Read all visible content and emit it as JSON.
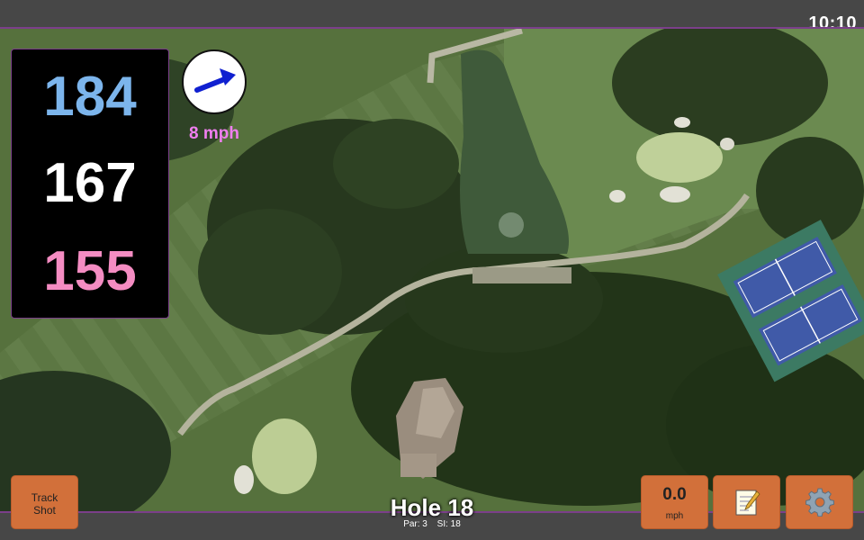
{
  "status_bar": {
    "time": "10:10"
  },
  "distances": {
    "back": "184",
    "middle": "167",
    "front": "155"
  },
  "wind": {
    "speed_label": "8 mph",
    "direction_icon": "arrow-icon"
  },
  "buttons": {
    "track_shot_line1": "Track",
    "track_shot_line2": "Shot",
    "speed_value": "0.0",
    "speed_unit": "mph",
    "notes_icon": "notepad-icon",
    "settings_icon": "gear-icon"
  },
  "hole": {
    "title": "Hole 18",
    "par": "Par: 3",
    "si": "SI: 18"
  },
  "colors": {
    "back_distance": "#7cb5ec",
    "middle_distance": "#ffffff",
    "front_distance": "#f48cc2",
    "wind_label": "#f07ff0",
    "button_bg": "#d2703a",
    "wind_arrow": "#1020d0"
  }
}
